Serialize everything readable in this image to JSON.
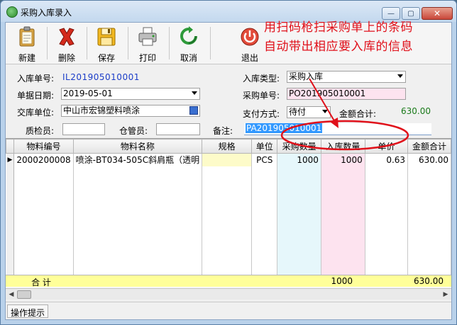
{
  "window": {
    "title": "采购入库录入",
    "controls": {
      "minimize": "—",
      "maximize": "▢",
      "close": "✕"
    }
  },
  "toolbar": {
    "new_label": "新建",
    "delete_label": "删除",
    "save_label": "保存",
    "print_label": "打印",
    "cancel_label": "取消",
    "exit_label": "退出"
  },
  "annotation": {
    "line1": "用扫码枪扫采购单上的条码",
    "line2": "自动带出相应要入库的信息",
    "color": "#e0101a"
  },
  "form": {
    "receipt_no_label": "入库单号:",
    "receipt_no": "IL201905010001",
    "date_label": "单据日期:",
    "date": "2019-05-01",
    "supplier_label": "交库单位:",
    "supplier": "中山市宏锦塑料喷涂",
    "inspector_label": "质检员:",
    "inspector": "",
    "keeper_label": "仓管员:",
    "keeper": "",
    "type_label": "入库类型:",
    "type": "采购入库",
    "po_no_label": "采购单号:",
    "po_no": "PO201905010001",
    "payment_label": "支付方式:",
    "payment": "待付",
    "amount_label": "金额合计:",
    "amount": "630.00",
    "remark_label": "备注:",
    "remark": "PA201905010001"
  },
  "grid": {
    "columns": [
      "物料编号",
      "物料名称",
      "规格",
      "单位",
      "采购数量",
      "入库数量",
      "单价",
      "金额合计"
    ],
    "rows": [
      [
        "2000200008",
        "喷涂-BT034-505C斜肩瓶（透明",
        "",
        "PCS",
        "1000",
        "1000",
        "0.63",
        "630.00"
      ]
    ],
    "total_label": "合 计",
    "total_in_qty": "1000",
    "total_amount": "630.00"
  },
  "status": {
    "hint_label": "操作提示"
  }
}
